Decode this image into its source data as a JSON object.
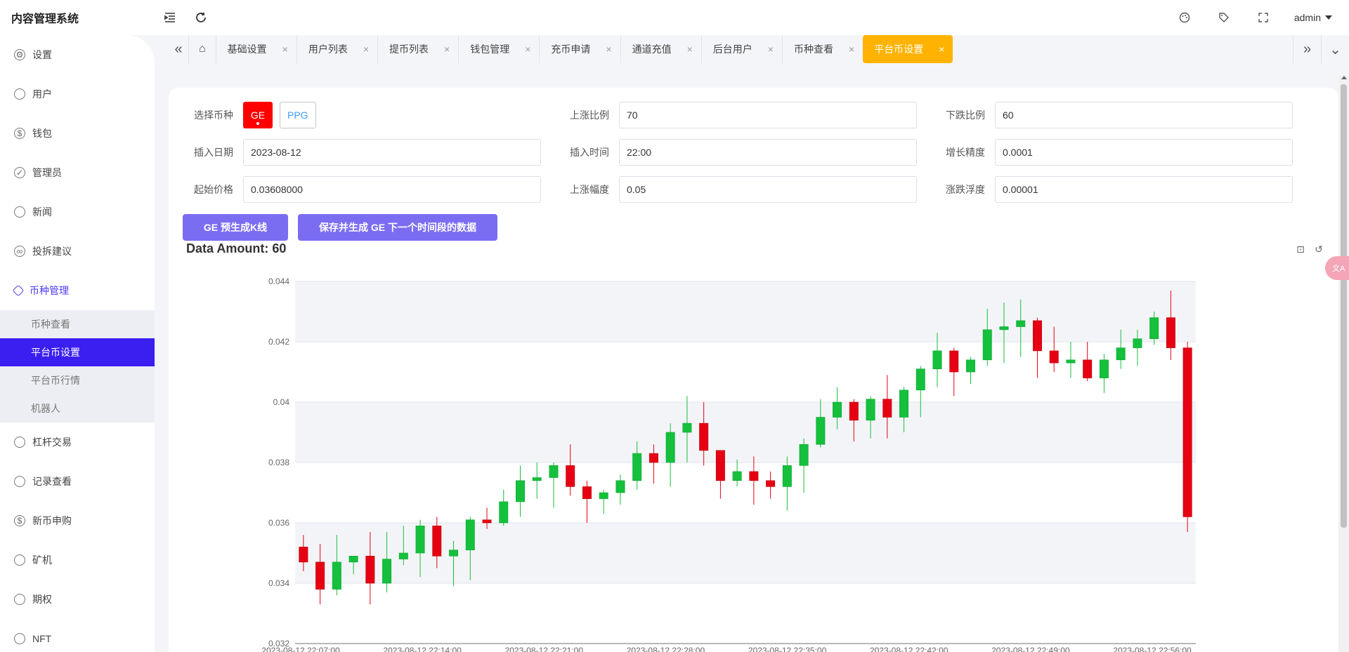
{
  "app": {
    "title": "内容管理系统",
    "user": "admin"
  },
  "sidebar": {
    "items": [
      {
        "label": "设置",
        "icon": "gear-icon"
      },
      {
        "label": "用户",
        "icon": "user-icon"
      },
      {
        "label": "钱包",
        "icon": "dollar-icon"
      },
      {
        "label": "管理员",
        "icon": "shield-icon"
      },
      {
        "label": "新闻",
        "icon": "tag-icon"
      },
      {
        "label": "投拆建议",
        "icon": "link-icon"
      },
      {
        "label": "币种管理",
        "icon": "gem-icon"
      }
    ],
    "submenu": [
      {
        "label": "币种查看"
      },
      {
        "label": "平台币设置"
      },
      {
        "label": "平台币行情"
      },
      {
        "label": "机器人"
      }
    ],
    "items_after": [
      {
        "label": "杠杆交易",
        "icon": "gem-icon"
      },
      {
        "label": "记录查看",
        "icon": "record-icon"
      },
      {
        "label": "新币申购",
        "icon": "dollar-icon"
      },
      {
        "label": "矿机",
        "icon": "record-icon"
      },
      {
        "label": "期权",
        "icon": "record-icon"
      },
      {
        "label": "NFT",
        "icon": "record-icon"
      }
    ]
  },
  "tabs": [
    {
      "label": "基础设置"
    },
    {
      "label": "用户列表"
    },
    {
      "label": "提币列表"
    },
    {
      "label": "钱包管理"
    },
    {
      "label": "充币申请"
    },
    {
      "label": "通道充值"
    },
    {
      "label": "后台用户"
    },
    {
      "label": "币种查看"
    },
    {
      "label": "平台币设置"
    }
  ],
  "form": {
    "coin_label": "选择币种",
    "coins": [
      "GE",
      "PPG"
    ],
    "selected_coin": "GE",
    "rise_ratio_label": "上涨比例",
    "rise_ratio": "70",
    "fall_ratio_label": "下跌比例",
    "fall_ratio": "60",
    "insert_date_label": "插入日期",
    "insert_date": "2023-08-12",
    "insert_time_label": "插入时间",
    "insert_time": "22:00",
    "precision_label": "增长精度",
    "precision": "0.0001",
    "start_price_label": "起始价格",
    "start_price": "0.03608000",
    "rise_range_label": "上涨幅度",
    "rise_range": "0.05",
    "float_label": "涨跌浮度",
    "float": "0.00001"
  },
  "actions": {
    "pregen": "GE 预生成K线",
    "save_next": "保存并生成 GE 下一个时间段的数据"
  },
  "data_amount": "Data Amount: 60",
  "colors": {
    "up": "#14c03c",
    "down": "#e60012",
    "accent": "#3b1ff0",
    "tab_active": "#ffb300",
    "button": "#7b6df2"
  },
  "chart_data": {
    "type": "candlestick",
    "ylim": [
      0.032,
      0.044
    ],
    "yticks": [
      "0.044",
      "0.042",
      "0.04",
      "0.038",
      "0.036",
      "0.034",
      "0.032"
    ],
    "xticks": [
      "2023-08-12 22:07:00",
      "2023-08-12 22:14:00",
      "2023-08-12 22:21:00",
      "2023-08-12 22:28:00",
      "2023-08-12 22:35:00",
      "2023-08-12 22:42:00",
      "2023-08-12 22:49:00",
      "2023-08-12 22:56:00"
    ],
    "candles": [
      [
        0.0352,
        0.0347,
        0.0356,
        0.0344
      ],
      [
        0.0347,
        0.0338,
        0.0353,
        0.0333
      ],
      [
        0.0338,
        0.0347,
        0.0356,
        0.0336
      ],
      [
        0.0347,
        0.0349,
        0.0349,
        0.0343
      ],
      [
        0.0349,
        0.034,
        0.0357,
        0.0333
      ],
      [
        0.034,
        0.0348,
        0.0357,
        0.0337
      ],
      [
        0.0348,
        0.035,
        0.0359,
        0.0346
      ],
      [
        0.035,
        0.0359,
        0.0361,
        0.0342
      ],
      [
        0.0359,
        0.0349,
        0.0362,
        0.0345
      ],
      [
        0.0349,
        0.0351,
        0.0354,
        0.0339
      ],
      [
        0.0351,
        0.0361,
        0.0362,
        0.0341
      ],
      [
        0.0361,
        0.036,
        0.0365,
        0.0358
      ],
      [
        0.036,
        0.0367,
        0.0371,
        0.0359
      ],
      [
        0.0367,
        0.0374,
        0.0379,
        0.0362
      ],
      [
        0.0374,
        0.0375,
        0.038,
        0.0368
      ],
      [
        0.0375,
        0.0379,
        0.038,
        0.0365
      ],
      [
        0.0379,
        0.0372,
        0.0386,
        0.0369
      ],
      [
        0.0372,
        0.0368,
        0.0374,
        0.036
      ],
      [
        0.0368,
        0.037,
        0.0371,
        0.0363
      ],
      [
        0.037,
        0.0374,
        0.0376,
        0.0366
      ],
      [
        0.0374,
        0.0383,
        0.0387,
        0.0371
      ],
      [
        0.0383,
        0.038,
        0.0386,
        0.0373
      ],
      [
        0.038,
        0.039,
        0.0393,
        0.0372
      ],
      [
        0.039,
        0.0393,
        0.0402,
        0.038
      ],
      [
        0.0393,
        0.0384,
        0.04,
        0.0379
      ],
      [
        0.0384,
        0.0374,
        0.0384,
        0.0368
      ],
      [
        0.0374,
        0.0377,
        0.0381,
        0.0372
      ],
      [
        0.0377,
        0.0374,
        0.0382,
        0.0366
      ],
      [
        0.0374,
        0.0372,
        0.0377,
        0.0368
      ],
      [
        0.0372,
        0.0379,
        0.0382,
        0.0364
      ],
      [
        0.0379,
        0.0386,
        0.0388,
        0.037
      ],
      [
        0.0386,
        0.0395,
        0.0401,
        0.0385
      ],
      [
        0.0395,
        0.04,
        0.0405,
        0.0391
      ],
      [
        0.04,
        0.0394,
        0.0401,
        0.0387
      ],
      [
        0.0394,
        0.0401,
        0.0402,
        0.0388
      ],
      [
        0.0401,
        0.0395,
        0.0409,
        0.0388
      ],
      [
        0.0395,
        0.0404,
        0.0405,
        0.039
      ],
      [
        0.0404,
        0.0411,
        0.0412,
        0.0395
      ],
      [
        0.0411,
        0.0417,
        0.0423,
        0.0405
      ],
      [
        0.0417,
        0.041,
        0.0418,
        0.0402
      ],
      [
        0.041,
        0.0414,
        0.0415,
        0.0406
      ],
      [
        0.0414,
        0.0424,
        0.0431,
        0.0412
      ],
      [
        0.0424,
        0.0425,
        0.0433,
        0.0413
      ],
      [
        0.0425,
        0.0427,
        0.0434,
        0.0415
      ],
      [
        0.0427,
        0.0417,
        0.0428,
        0.0408
      ],
      [
        0.0417,
        0.0413,
        0.0425,
        0.041
      ],
      [
        0.0413,
        0.0414,
        0.042,
        0.0408
      ],
      [
        0.0414,
        0.0408,
        0.042,
        0.0407
      ],
      [
        0.0408,
        0.0414,
        0.0416,
        0.0403
      ],
      [
        0.0414,
        0.0418,
        0.0424,
        0.0411
      ],
      [
        0.0418,
        0.0421,
        0.0424,
        0.0412
      ],
      [
        0.0421,
        0.0428,
        0.043,
        0.0419
      ],
      [
        0.0428,
        0.0418,
        0.0437,
        0.0414
      ],
      [
        0.0418,
        0.0362,
        0.042,
        0.0357
      ]
    ]
  }
}
